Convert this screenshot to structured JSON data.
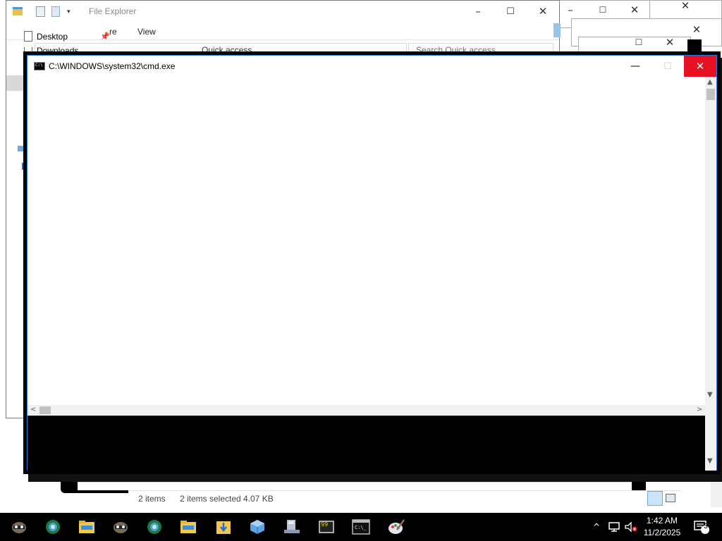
{
  "file_explorer": {
    "title": "File Explorer",
    "ribbon_tabs": [
      "re",
      "View"
    ],
    "nav_items": [
      {
        "label": "Desktop"
      },
      {
        "label": "Downloads"
      }
    ],
    "address": "Quick access",
    "search_placeholder": "Search Quick access",
    "status": {
      "item_count": "2 items",
      "selected": "2 items selected",
      "size": "4.07 KB"
    }
  },
  "cmd_window": {
    "title": "C:\\WINDOWS\\system32\\cmd.exe",
    "icon_text": "C:\\",
    "close_color": "#e81123",
    "border_color": "#2b79d7"
  },
  "taskbar": {
    "apps": [
      {
        "icon": "raccoon-app-icon"
      },
      {
        "icon": "globe-browser-icon"
      },
      {
        "icon": "folder-icon"
      },
      {
        "icon": "raccoon-app-icon"
      },
      {
        "icon": "globe-browser-icon"
      },
      {
        "icon": "folder-icon"
      },
      {
        "icon": "download-folder-icon"
      },
      {
        "icon": "virtualbox-cube-icon"
      },
      {
        "icon": "computer-icon"
      },
      {
        "icon": "notepad-plus-icon"
      },
      {
        "icon": "terminal-icon"
      },
      {
        "icon": "paint-icon"
      }
    ],
    "clock_time": "1:42 AM",
    "clock_date": "11/2/2025",
    "notification_count": "3"
  }
}
